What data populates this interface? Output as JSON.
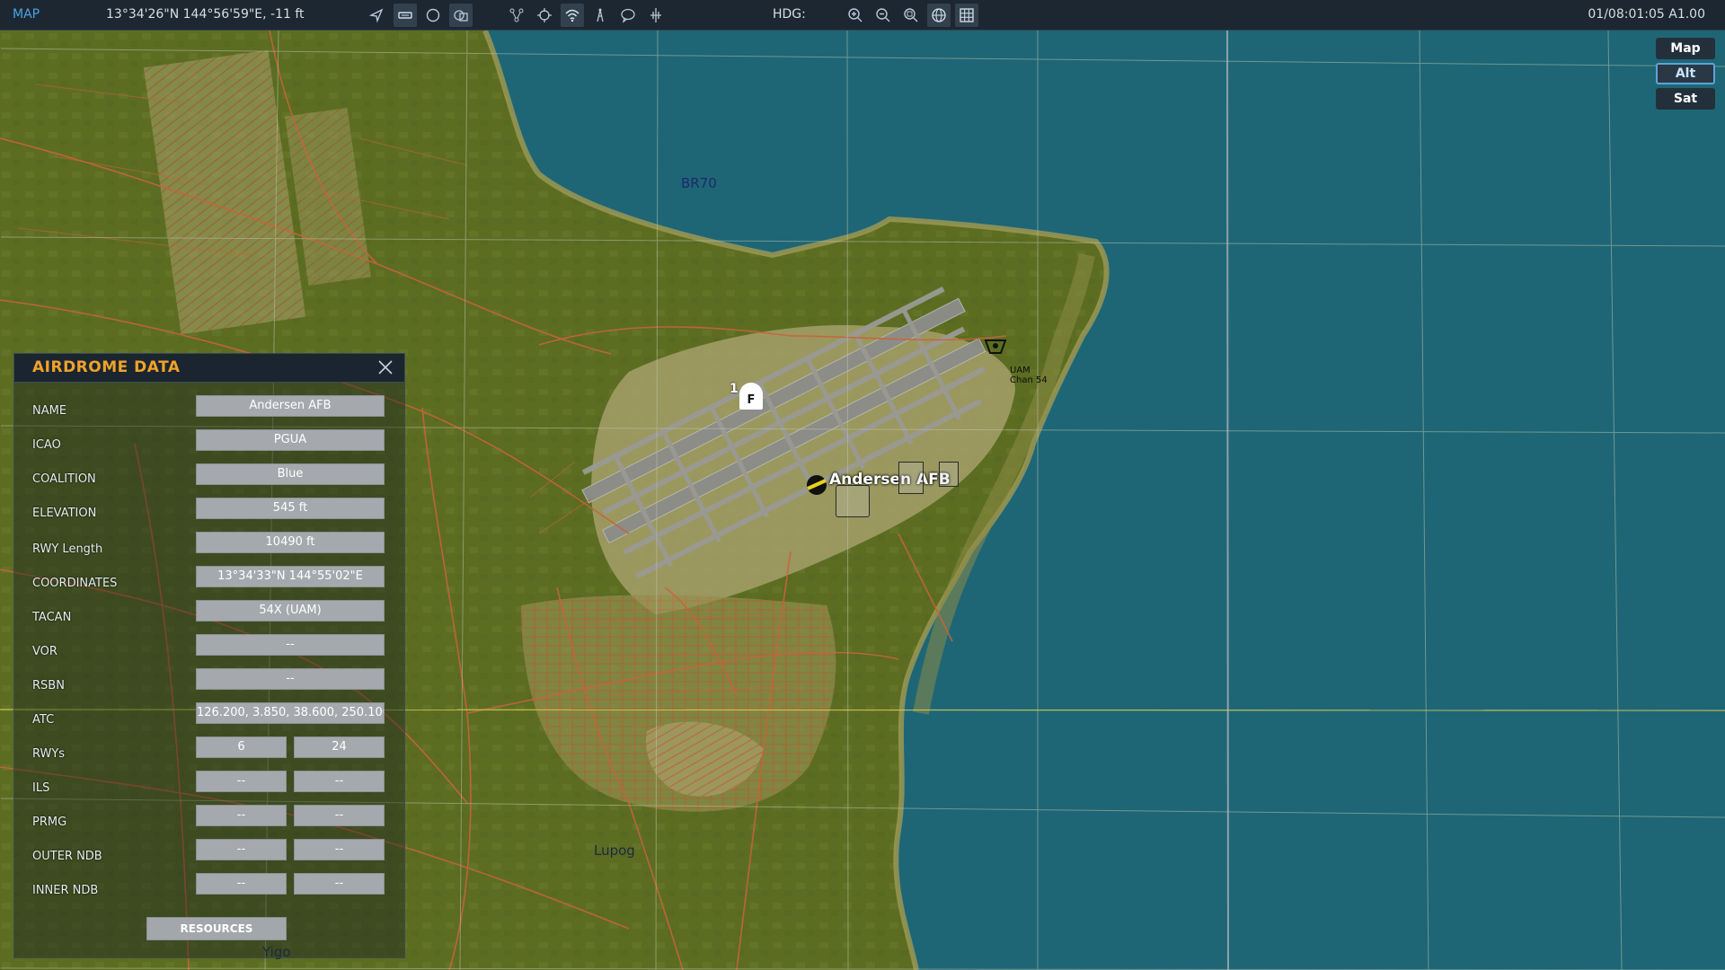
{
  "toolbar": {
    "app_label": "MAP",
    "coordinates": "13°34'26\"N 144°56'59\"E, -11 ft",
    "hdg_label": "HDG:",
    "clock": "01/08:01:05 A1.00",
    "icons": [
      "send-icon",
      "route-icon",
      "circle-icon",
      "layers-icon",
      "network-icon",
      "crosshair-icon",
      "signal-icon",
      "tower-icon",
      "chat-icon",
      "ruler-icon",
      "zoom-in-icon",
      "zoom-out-icon",
      "zoom-fit-icon",
      "globe-icon",
      "grid-icon"
    ]
  },
  "map_type": {
    "buttons": [
      "Map",
      "Alt",
      "Sat"
    ],
    "selected": "Alt"
  },
  "map": {
    "labels": {
      "br70": "BR70",
      "airbase": "Andersen AFB",
      "nav_line1": "UAM",
      "nav_line2": "Chan 54",
      "town1": "Lupog",
      "town2": "Yigo",
      "farp_number": "1",
      "farp_letter": "F"
    },
    "colors": {
      "water": "#1e6675",
      "land": "#5c6d22",
      "roads": "#c8643a"
    }
  },
  "panel": {
    "title": "AIRDROME DATA",
    "rows": {
      "name": {
        "label": "NAME",
        "value": "Andersen AFB"
      },
      "icao": {
        "label": "ICAO",
        "value": "PGUA"
      },
      "coalition": {
        "label": "COALITION",
        "value": "Blue"
      },
      "elevation": {
        "label": "ELEVATION",
        "value": "545 ft"
      },
      "rwy_length": {
        "label": "RWY Length",
        "value": "10490 ft"
      },
      "coordinates": {
        "label": "COORDINATES",
        "value": "13°34'33\"N 144°55'02\"E"
      },
      "tacan": {
        "label": "TACAN",
        "value": "54X (UAM)"
      },
      "vor": {
        "label": "VOR",
        "value": "--"
      },
      "rsbn": {
        "label": "RSBN",
        "value": "--"
      },
      "atc": {
        "label": "ATC",
        "value": "126.200, 3.850, 38.600, 250.100"
      },
      "rwys": {
        "label": "RWYs",
        "a": "6",
        "b": "24"
      },
      "ils": {
        "label": "ILS",
        "a": "--",
        "b": "--"
      },
      "prmg": {
        "label": "PRMG",
        "a": "--",
        "b": "--"
      },
      "outer_ndb": {
        "label": "OUTER NDB",
        "a": "--",
        "b": "--"
      },
      "inner_ndb": {
        "label": "INNER NDB",
        "a": "--",
        "b": "--"
      }
    },
    "resources_label": "RESOURCES"
  }
}
